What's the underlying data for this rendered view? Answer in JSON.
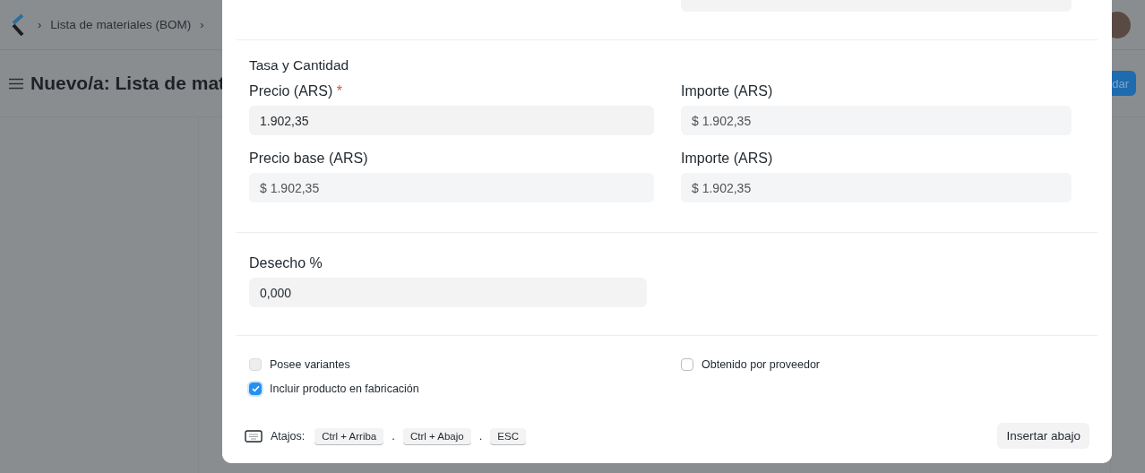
{
  "navbar": {
    "breadcrumbs": [
      {
        "label": "Lista de materiales (BOM)"
      }
    ],
    "separator": "›"
  },
  "page_header": {
    "title": "Nuevo/a: Lista de mat",
    "button": "dar"
  },
  "dialog": {
    "section": {
      "title": "Tasa y Cantidad"
    },
    "required_marker": "*",
    "fields": [
      {
        "label": "Precio (ARS)",
        "required": true,
        "value": "1.902,35",
        "readonly": false
      },
      {
        "label": "Importe (ARS)",
        "required": false,
        "value": "$ 1.902,35",
        "readonly": true
      },
      {
        "label": "Precio base (ARS)",
        "required": false,
        "value": "$ 1.902,35",
        "readonly": true
      },
      {
        "label": "Importe (ARS)",
        "required": false,
        "value": "$ 1.902,35",
        "readonly": true
      }
    ],
    "scrap_field": {
      "label": "Desecho %",
      "value": "0,000"
    },
    "checkboxes": [
      {
        "label": "Posee variantes",
        "checked": false,
        "disabled": true
      },
      {
        "label": "Obtenido por proveedor",
        "checked": false,
        "disabled": false
      },
      {
        "label": "Incluir producto en fabricación",
        "checked": true,
        "disabled": false
      }
    ],
    "shortcuts": {
      "label": "Atajos:",
      "keys": [
        "Ctrl + Arriba",
        "Ctrl + Abajo",
        "ESC"
      ],
      "separator": "."
    },
    "action_button": "Insertar abajo"
  }
}
